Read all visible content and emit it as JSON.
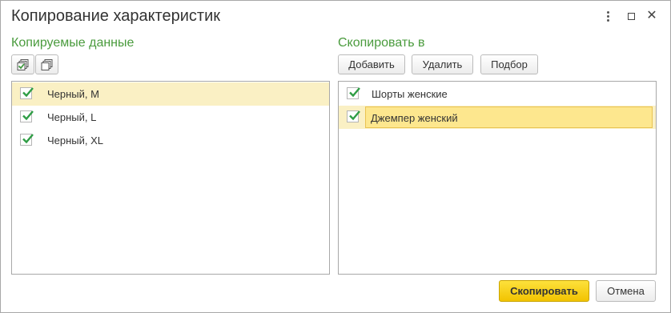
{
  "window": {
    "title": "Копирование характеристик"
  },
  "left": {
    "label": "Копируемые данные",
    "items": [
      {
        "label": "Черный, M",
        "checked": true
      },
      {
        "label": "Черный, L",
        "checked": true
      },
      {
        "label": "Черный, XL",
        "checked": true
      }
    ]
  },
  "right": {
    "label": "Скопировать в",
    "buttons": {
      "add": "Добавить",
      "delete": "Удалить",
      "select": "Подбор"
    },
    "items": [
      {
        "label": "Шорты женские",
        "checked": true
      },
      {
        "label": "Джемпер женский",
        "checked": true
      }
    ]
  },
  "footer": {
    "copy": "Скопировать",
    "cancel": "Отмена"
  },
  "colors": {
    "accent_green": "#4a9b3d",
    "selected_row": "#faf0c4",
    "edit_cell": "#fde78e",
    "primary_button": "#f7d21c"
  },
  "icons": {
    "check_all": "check-all-icon",
    "uncheck_all": "uncheck-all-icon",
    "more": "more-icon",
    "maximize": "maximize-icon",
    "close": "close-icon"
  }
}
